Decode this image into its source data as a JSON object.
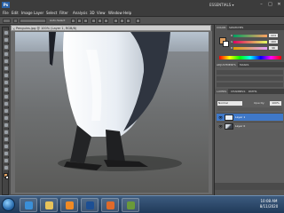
{
  "app": {
    "logo": "Ps",
    "workspace": "ESSENTIALS ▾"
  },
  "window_controls": {
    "minimize": "–",
    "maximize": "□",
    "close": "✕"
  },
  "menu": [
    "File",
    "Edit",
    "Image",
    "Layer",
    "Select",
    "Filter",
    "Analysis",
    "3D",
    "View",
    "Window",
    "Help"
  ],
  "options_bar": {
    "auto_select": "Auto-Select"
  },
  "document": {
    "tab_title": "Penguins.jpg @ 100% (Layer 1, RGB/8)",
    "close": "×"
  },
  "panels": {
    "color_tabs": [
      "COLOR",
      "SWATCHES"
    ],
    "color_sliders": [
      {
        "label": "R",
        "value": "224"
      },
      {
        "label": "G",
        "value": "160"
      },
      {
        "label": "B",
        "value": "96"
      }
    ],
    "mid_tabs": [
      "ADJUSTMENTS",
      "MASKS"
    ],
    "layers_tabs": [
      "LAYERS",
      "CHANNELS",
      "PATHS"
    ],
    "blend_mode": "Normal",
    "opacity_label": "Opacity:",
    "opacity_value": "100%",
    "layers": [
      {
        "name": "Layer 1",
        "selected": true
      },
      {
        "name": "Layer 0",
        "selected": false
      }
    ]
  },
  "taskbar": {
    "time": "10:08 AM",
    "date": "8/11/2020"
  },
  "colors": {
    "foreground": "#e0a060",
    "background": "#ffffff",
    "selection": "#3f78c8"
  }
}
